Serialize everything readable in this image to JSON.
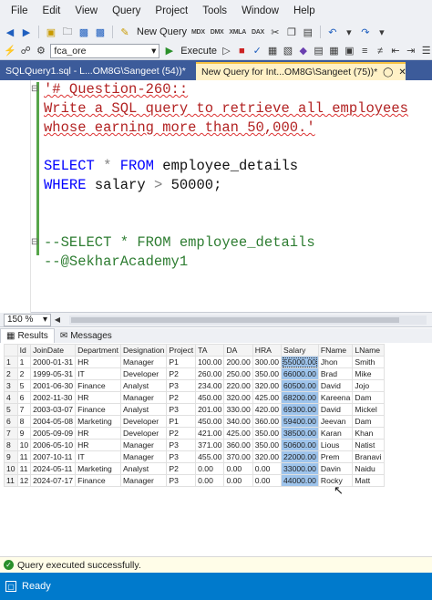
{
  "menu": [
    "File",
    "Edit",
    "View",
    "Query",
    "Project",
    "Tools",
    "Window",
    "Help"
  ],
  "toolbar": {
    "new_query_label": "New Query",
    "database_value": "fca_ore",
    "execute_label": "Execute",
    "mdx_labels": [
      "MDX",
      "DMX",
      "XMLA",
      "DAX"
    ]
  },
  "tabs": [
    {
      "label": "SQLQuery1.sql - L...OM8G\\Sangeet (54))*",
      "active": false
    },
    {
      "label": "New Query for Int...OM8G\\Sangeet (75))*",
      "active": true
    }
  ],
  "editor": {
    "lines": [
      {
        "text": "'# Question-260::",
        "style": "string-squig"
      },
      {
        "text": "Write a SQL query to retrieve all employees",
        "style": "string-squig"
      },
      {
        "text": "whose earning more than 50,000.'",
        "style": "string-squig"
      },
      {
        "text": "",
        "style": "plain"
      },
      {
        "kw1": "SELECT",
        "op1": "*",
        "kw2": "FROM",
        "ident": "employee_details",
        "style": "select"
      },
      {
        "kw1": "WHERE",
        "ident": "salary",
        "op1": ">",
        "num": "50000;",
        "style": "where"
      },
      {
        "text": "",
        "style": "plain"
      },
      {
        "text": "",
        "style": "plain"
      },
      {
        "text": "--SELECT * FROM employee_details",
        "style": "comment"
      },
      {
        "text": "--@SekharAcademy1",
        "style": "comment"
      }
    ]
  },
  "zoom": "150 %",
  "result_tabs": {
    "results": "Results",
    "messages": "Messages"
  },
  "table": {
    "columns": [
      "",
      "Id",
      "JoinDate",
      "Department",
      "Designation",
      "Project",
      "TA",
      "DA",
      "HRA",
      "Salary",
      "FName",
      "LName"
    ],
    "rows": [
      [
        "1",
        "1",
        "2000-01-31",
        "HR",
        "Manager",
        "P1",
        "100.00",
        "200.00",
        "300.00",
        "55000.00",
        "Jhon",
        "Smith"
      ],
      [
        "2",
        "2",
        "1999-05-31",
        "IT",
        "Developer",
        "P2",
        "260.00",
        "250.00",
        "350.00",
        "66000.00",
        "Brad",
        "Mike"
      ],
      [
        "3",
        "5",
        "2001-06-30",
        "Finance",
        "Analyst",
        "P3",
        "234.00",
        "220.00",
        "320.00",
        "60500.00",
        "David",
        "Jojo"
      ],
      [
        "4",
        "6",
        "2002-11-30",
        "HR",
        "Manager",
        "P2",
        "450.00",
        "320.00",
        "425.00",
        "68200.00",
        "Kareena",
        "Dam"
      ],
      [
        "5",
        "7",
        "2003-03-07",
        "Finance",
        "Analyst",
        "P3",
        "201.00",
        "330.00",
        "420.00",
        "69300.00",
        "David",
        "Mickel"
      ],
      [
        "6",
        "8",
        "2004-05-08",
        "Marketing",
        "Developer",
        "P1",
        "450.00",
        "340.00",
        "360.00",
        "59400.00",
        "Jeevan",
        "Dam"
      ],
      [
        "7",
        "9",
        "2005-09-09",
        "HR",
        "Developer",
        "P2",
        "421.00",
        "425.00",
        "350.00",
        "38500.00",
        "Karan",
        "Khan"
      ],
      [
        "8",
        "10",
        "2006-05-10",
        "HR",
        "Manager",
        "P3",
        "371.00",
        "360.00",
        "350.00",
        "50600.00",
        "Lious",
        "Natist"
      ],
      [
        "9",
        "11",
        "2007-10-11",
        "IT",
        "Manager",
        "P3",
        "455.00",
        "370.00",
        "320.00",
        "22000.00",
        "Prem",
        "Branavi"
      ],
      [
        "10",
        "11",
        "2024-05-11",
        "Marketing",
        "Analyst",
        "P2",
        "0.00",
        "0.00",
        "0.00",
        "33000.00",
        "Davin",
        "Naidu"
      ],
      [
        "11",
        "12",
        "2024-07-17",
        "Finance",
        "Manager",
        "P3",
        "0.00",
        "0.00",
        "0.00",
        "44000.00",
        "Rocky",
        "Matt"
      ]
    ]
  },
  "status": {
    "message": "Query executed successfully.",
    "ready": "Ready"
  }
}
